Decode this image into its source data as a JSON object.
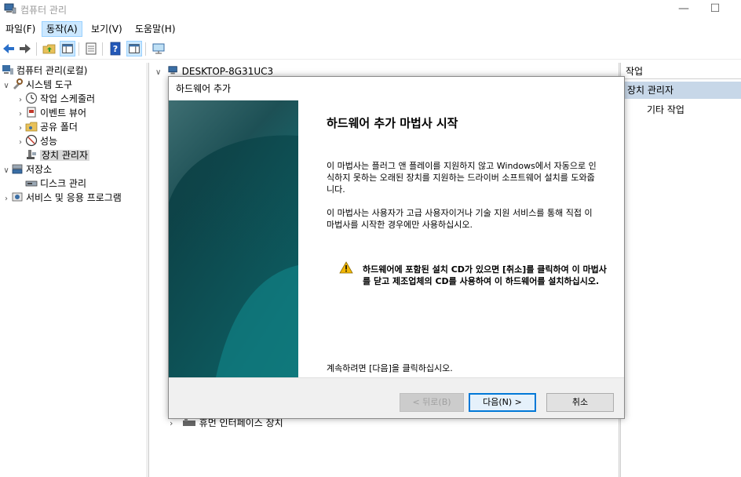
{
  "window": {
    "title": "컴퓨터 관리",
    "minimize_glyph": "—",
    "maximize_glyph": "☐"
  },
  "menu": {
    "items": [
      "파일(F)",
      "동작(A)",
      "보기(V)",
      "도움말(H)"
    ],
    "active_index": 1
  },
  "toolbar": {
    "buttons": [
      "back-arrow-icon",
      "forward-arrow-icon",
      "folder-up-icon",
      "console-tree-icon",
      "properties-icon",
      "help-icon",
      "action-pane-icon",
      "monitor-icon"
    ]
  },
  "tree": {
    "root": "컴퓨터 관리(로컬)",
    "system_tools": "시스템 도구",
    "task_scheduler": "작업 스케줄러",
    "event_viewer": "이벤트 뷰어",
    "shared_folders": "공유 폴더",
    "performance": "성능",
    "device_manager": "장치 관리자",
    "storage": "저장소",
    "disk_management": "디스크 관리",
    "services": "서비스 및 응용 프로그램"
  },
  "center": {
    "computer_name": "DESKTOP-8G31UC3",
    "last_node": "휴먼 인터페이스 장치"
  },
  "actions": {
    "header": "작업",
    "selected": "장치 관리자",
    "more": "기타 작업",
    "more_arrow": "▶"
  },
  "wizard": {
    "title": "하드웨어 추가",
    "heading": "하드웨어 추가 마법사 시작",
    "para1": "이 마법사는 플러그 앤 플레이를 지원하지 않고 Windows에서 자동으로 인식하지 못하는 오래된 장치를 지원하는 드라이버 소프트웨어 설치를 도와줍니다.",
    "para2": "이 마법사는 사용자가 고급 사용자이거나 기술 지원 서비스를 통해 직접 이 마법사를 시작한 경우에만 사용하십시오.",
    "warning": "하드웨어에 포함된 설치 CD가 있으면 [취소]를 클릭하여 이 마법사를 닫고 제조업체의 CD를 사용하여 이 하드웨어를 설치하십시오.",
    "continue_text": "계속하려면 [다음]을 클릭하십시오.",
    "back_button": "< 뒤로(B)",
    "next_button": "다음(N) >",
    "cancel_button": "취소"
  },
  "colors": {
    "accent": "#0078d7",
    "menu_active_bg": "#cce8ff",
    "action_selected_bg": "#c7d7e8",
    "wizard_side_dark": "#0f4a50",
    "wizard_side_light": "#2a8a8a"
  }
}
